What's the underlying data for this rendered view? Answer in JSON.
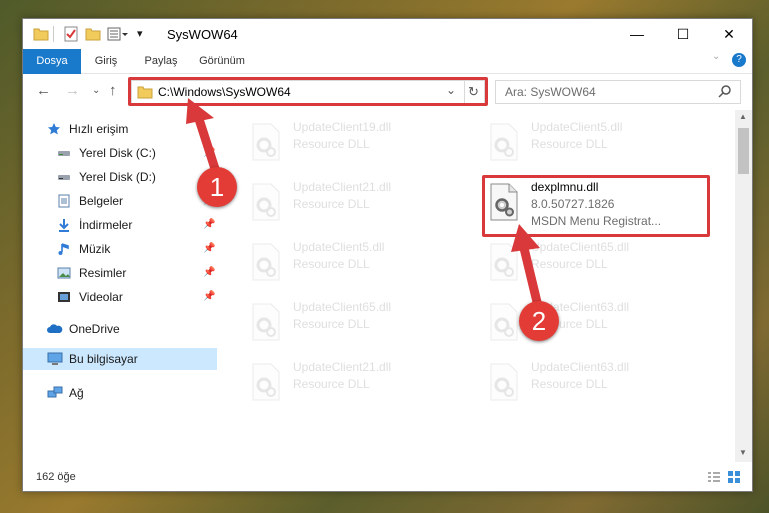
{
  "window": {
    "title": "SysWOW64",
    "min_glyph": "—",
    "max_glyph": "☐",
    "close_glyph": "✕"
  },
  "ribbon": {
    "tabs": [
      "Dosya",
      "Giriş",
      "Paylaş",
      "Görünüm"
    ],
    "file_color": "#1979ca",
    "help_glyph": "?"
  },
  "address": {
    "path": "C:\\Windows\\SysWOW64",
    "search_placeholder": "Ara: SysWOW64"
  },
  "sidebar": {
    "items": [
      {
        "label": "Hızlı erişim",
        "icon": "star-icon"
      },
      {
        "label": "Yerel Disk (C:)",
        "icon": "drive-icon",
        "pinned": true
      },
      {
        "label": "Yerel Disk (D:)",
        "icon": "drive-icon",
        "pinned": true
      },
      {
        "label": "Belgeler",
        "icon": "documents-icon",
        "pinned": true
      },
      {
        "label": "İndirmeler",
        "icon": "downloads-icon",
        "pinned": true
      },
      {
        "label": "Müzik",
        "icon": "music-icon",
        "pinned": true
      },
      {
        "label": "Resimler",
        "icon": "pictures-icon",
        "pinned": true
      },
      {
        "label": "Videolar",
        "icon": "videos-icon",
        "pinned": true
      },
      {
        "label": "OneDrive",
        "icon": "cloud-icon"
      },
      {
        "label": "Bu bilgisayar",
        "icon": "computer-icon",
        "selected": true
      },
      {
        "label": "Ağ",
        "icon": "network-icon"
      }
    ]
  },
  "files": [
    {
      "name": "UpdateClient19.dll",
      "desc": "Resource DLL",
      "faded": true
    },
    {
      "name": "UpdateClient5.dll",
      "desc": "Resource DLL",
      "faded": true
    },
    {
      "name": "UpdateClient21.dll",
      "desc": "Resource DLL",
      "faded": true
    },
    {
      "name": "dexplmnu.dll",
      "version": "8.0.50727.1826",
      "desc": "MSDN Menu Registrat...",
      "faded": false
    },
    {
      "name": "UpdateClient5.dll",
      "desc": "Resource DLL",
      "faded": true
    },
    {
      "name": "UpdateClient65.dll",
      "desc": "Resource DLL",
      "faded": true
    },
    {
      "name": "UpdateClient65.dll",
      "desc": "Resource DLL",
      "faded": true
    },
    {
      "name": "UpdateClient63.dll",
      "desc": "Resource DLL",
      "faded": true
    },
    {
      "name": "UpdateClient21.dll",
      "desc": "Resource DLL",
      "faded": true
    },
    {
      "name": "UpdateClient63.dll",
      "desc": "Resource DLL",
      "faded": true
    }
  ],
  "status": {
    "count": "162 öğe"
  },
  "annotations": {
    "step1": "1",
    "step2": "2",
    "highlight_color": "#d9393b"
  }
}
